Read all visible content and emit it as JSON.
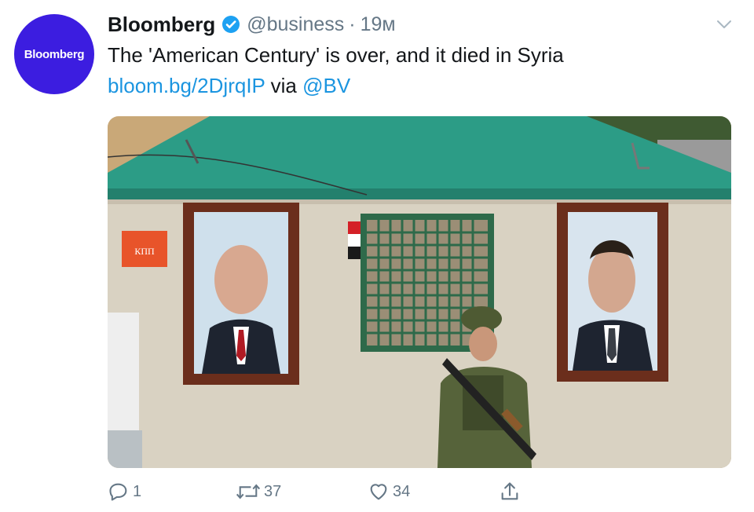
{
  "tweet": {
    "author": {
      "avatar_text": "Bloomberg",
      "name": "Bloomberg",
      "handle": "@business",
      "time": "19м"
    },
    "text_line1": "The 'American Century' is over, and it died in Syria",
    "link": "bloom.bg/2DjrqIP",
    "via": "via",
    "mention": "@BV",
    "photo": {
      "sign_text": "КПП",
      "colors": {
        "roof": "#2c9c86",
        "wall": "#d9d2c2",
        "frame": "#6b2e1c",
        "sign": "#e8542a"
      }
    },
    "actions": {
      "reply_count": "1",
      "retweet_count": "37",
      "like_count": "34"
    },
    "colors": {
      "accent": "#1b95e0",
      "muted": "#657786",
      "avatar_bg": "#3c1de0"
    }
  }
}
